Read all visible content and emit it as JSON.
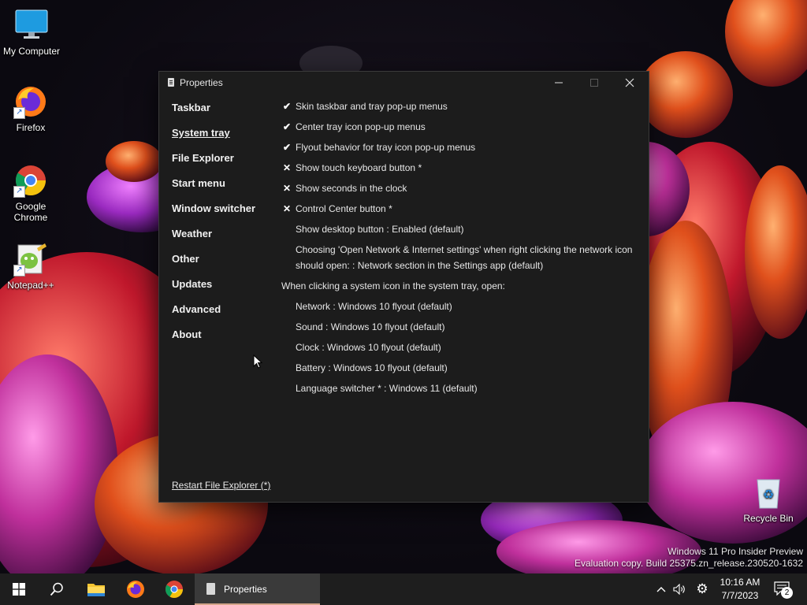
{
  "desktop": {
    "icons": [
      {
        "label": "My Computer"
      },
      {
        "label": "Firefox"
      },
      {
        "label": "Google Chrome"
      },
      {
        "label": "Notepad++"
      },
      {
        "label": "Recycle Bin"
      }
    ]
  },
  "window": {
    "title": "Properties",
    "nav": [
      {
        "label": "Taskbar",
        "active": false
      },
      {
        "label": "System tray",
        "active": true
      },
      {
        "label": "File Explorer",
        "active": false
      },
      {
        "label": "Start menu",
        "active": false
      },
      {
        "label": "Window switcher",
        "active": false
      },
      {
        "label": "Weather",
        "active": false
      },
      {
        "label": "Other",
        "active": false
      },
      {
        "label": "Updates",
        "active": false
      },
      {
        "label": "Advanced",
        "active": false
      },
      {
        "label": "About",
        "active": false
      }
    ],
    "options": [
      {
        "mark": "✔",
        "text": "Skin taskbar and tray pop-up menus"
      },
      {
        "mark": "✔",
        "text": "Center tray icon pop-up menus"
      },
      {
        "mark": "✔",
        "text": "Flyout behavior for tray icon pop-up menus"
      },
      {
        "mark": "✕",
        "text": "Show touch keyboard button *"
      },
      {
        "mark": "✕",
        "text": "Show seconds in the clock"
      },
      {
        "mark": "✕",
        "text": "Control Center button *"
      },
      {
        "mark": "",
        "text": "Show desktop button : Enabled (default)"
      },
      {
        "mark": "",
        "text": "Choosing 'Open Network & Internet settings' when right clicking the network icon should open: : Network section in the Settings app (default)"
      }
    ],
    "section_heading": "When clicking a system icon in the system tray, open:",
    "section_items": [
      "Network : Windows 10 flyout (default)",
      "Sound : Windows 10 flyout (default)",
      "Clock : Windows 10 flyout (default)",
      "Battery : Windows 10 flyout (default)",
      "Language switcher * : Windows 11 (default)"
    ],
    "restart_link": "Restart File Explorer (*)"
  },
  "watermark": {
    "line1": "Windows 11 Pro Insider Preview",
    "line2": "Evaluation copy. Build 25375.zn_release.230520-1632"
  },
  "taskbar": {
    "active_app_label": "Properties",
    "time": "10:16 AM",
    "date": "7/7/2023",
    "notification_count": "2",
    "pinned": [
      "start-icon",
      "search-icon",
      "file-explorer-icon",
      "firefox-icon",
      "chrome-icon"
    ]
  }
}
